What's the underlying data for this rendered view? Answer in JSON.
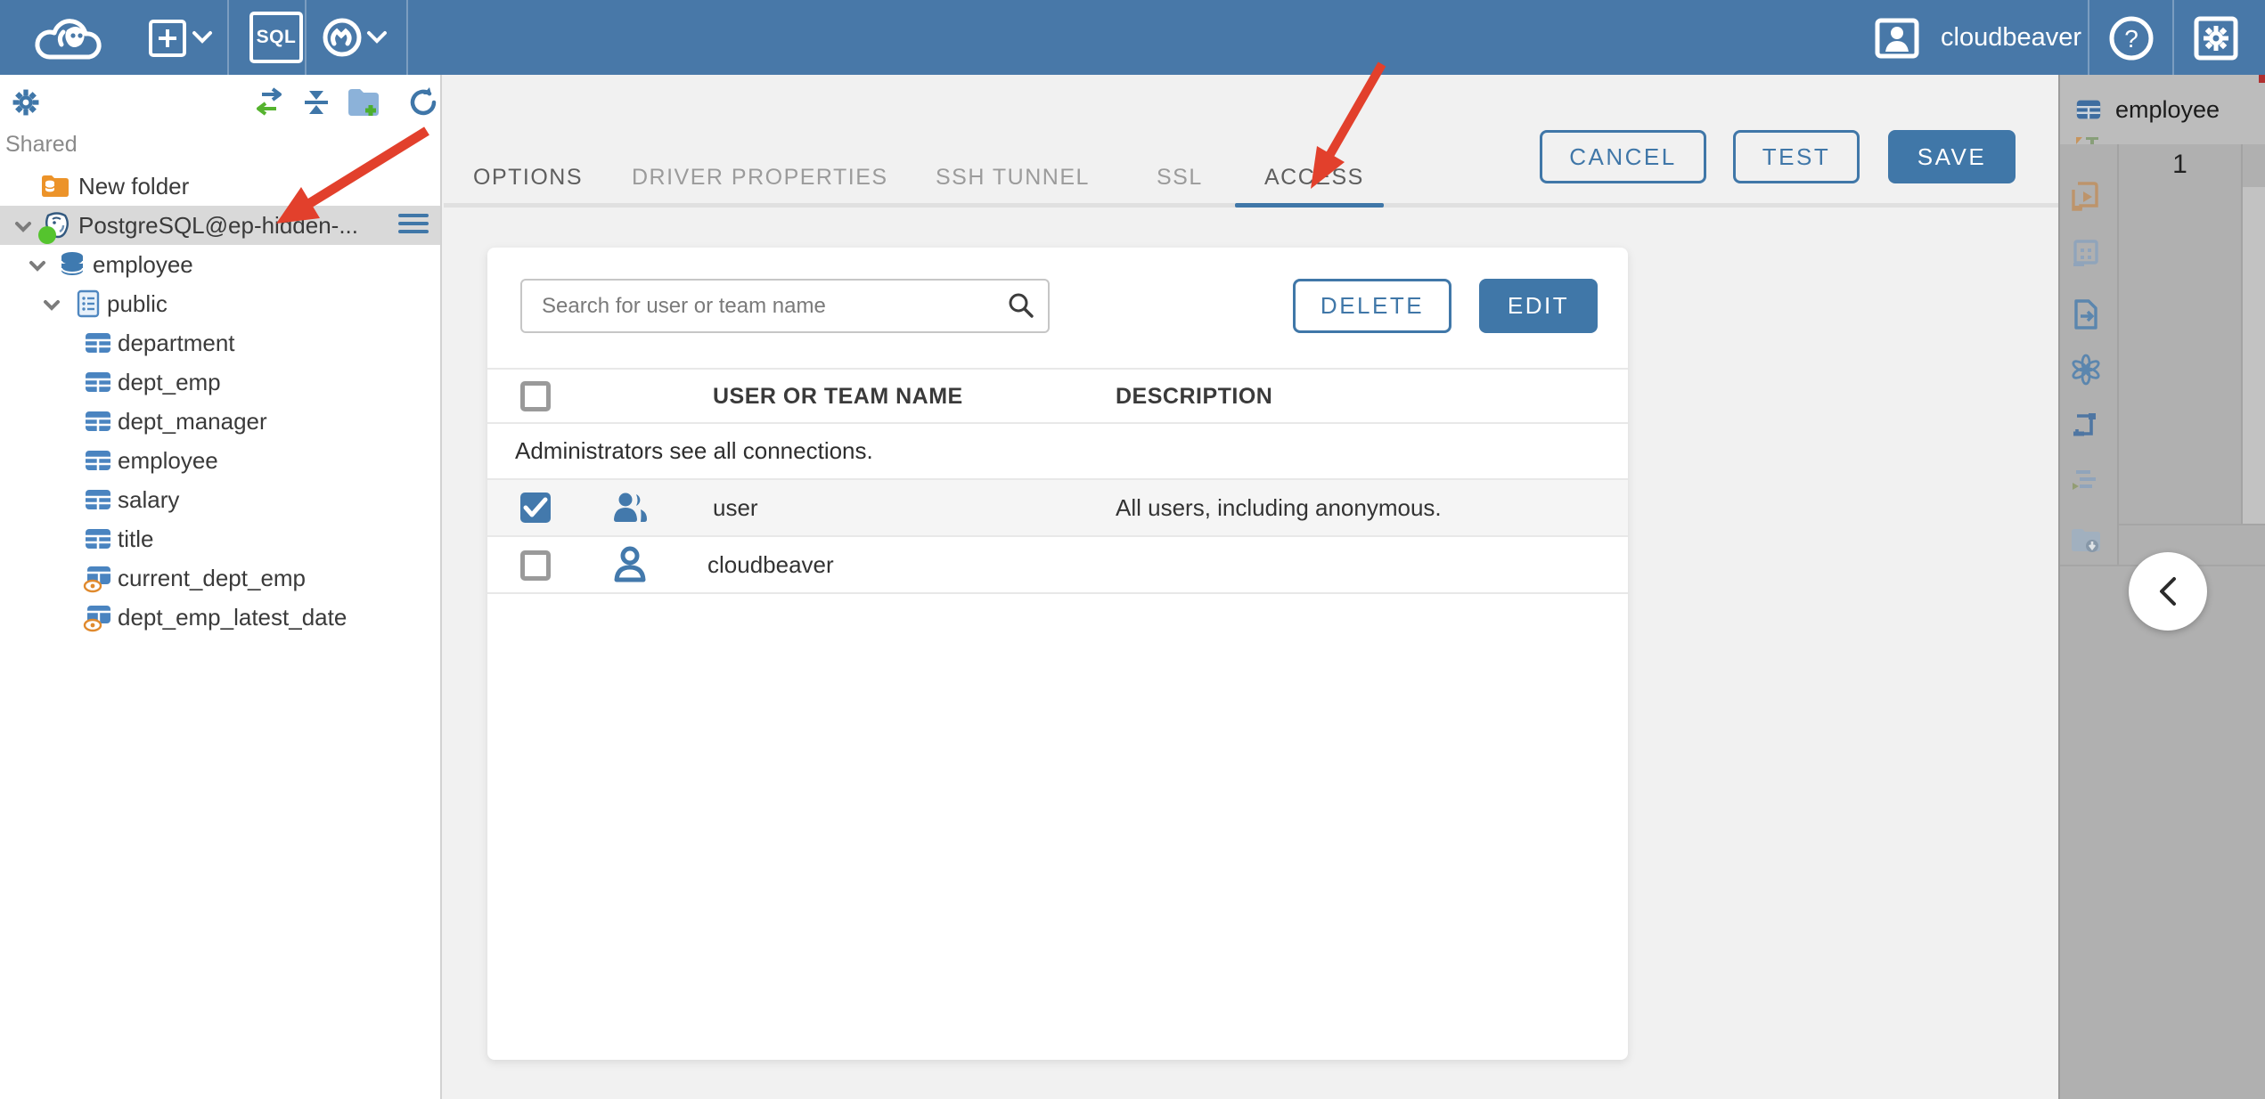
{
  "colors": {
    "header_bg": "#4878a8",
    "accent": "#4077a8",
    "arrow_red": "#e2402c",
    "status_green": "#55c42e",
    "selected_row": "#d9d9d9"
  },
  "header": {
    "sql_button_label": "SQL",
    "user_label": "cloudbeaver"
  },
  "sidebar": {
    "section_label": "Shared",
    "tree": [
      {
        "label": "New folder",
        "icon": "folder-database"
      },
      {
        "label": "PostgreSQL@ep-hidden-...",
        "icon": "postgresql",
        "selected": true,
        "status": "connected"
      },
      {
        "label": "employee",
        "icon": "database"
      },
      {
        "label": "public",
        "icon": "schema"
      },
      {
        "label": "department",
        "icon": "table"
      },
      {
        "label": "dept_emp",
        "icon": "table"
      },
      {
        "label": "dept_manager",
        "icon": "table"
      },
      {
        "label": "employee",
        "icon": "table"
      },
      {
        "label": "salary",
        "icon": "table"
      },
      {
        "label": "title",
        "icon": "table"
      },
      {
        "label": "current_dept_emp",
        "icon": "view"
      },
      {
        "label": "dept_emp_latest_date",
        "icon": "view"
      }
    ]
  },
  "main": {
    "tabs": [
      {
        "label": "OPTIONS"
      },
      {
        "label": "DRIVER PROPERTIES"
      },
      {
        "label": "SSH TUNNEL"
      },
      {
        "label": "SSL"
      },
      {
        "label": "ACCESS",
        "active": true
      }
    ],
    "actions": {
      "cancel": "CANCEL",
      "test": "TEST",
      "save": "SAVE"
    },
    "access": {
      "search_placeholder": "Search for user or team name",
      "delete_label": "DELETE",
      "edit_label": "EDIT",
      "columns": {
        "name": "USER OR TEAM NAME",
        "description": "DESCRIPTION"
      },
      "info_row": "Administrators see all connections.",
      "rows": [
        {
          "name": "user",
          "description": "All users, including anonymous.",
          "checked": true,
          "type": "team"
        },
        {
          "name": "cloudbeaver",
          "description": "",
          "checked": false,
          "type": "user"
        }
      ]
    }
  },
  "right_panel": {
    "tab_label": "employee",
    "grid_first_row_number": "1"
  }
}
